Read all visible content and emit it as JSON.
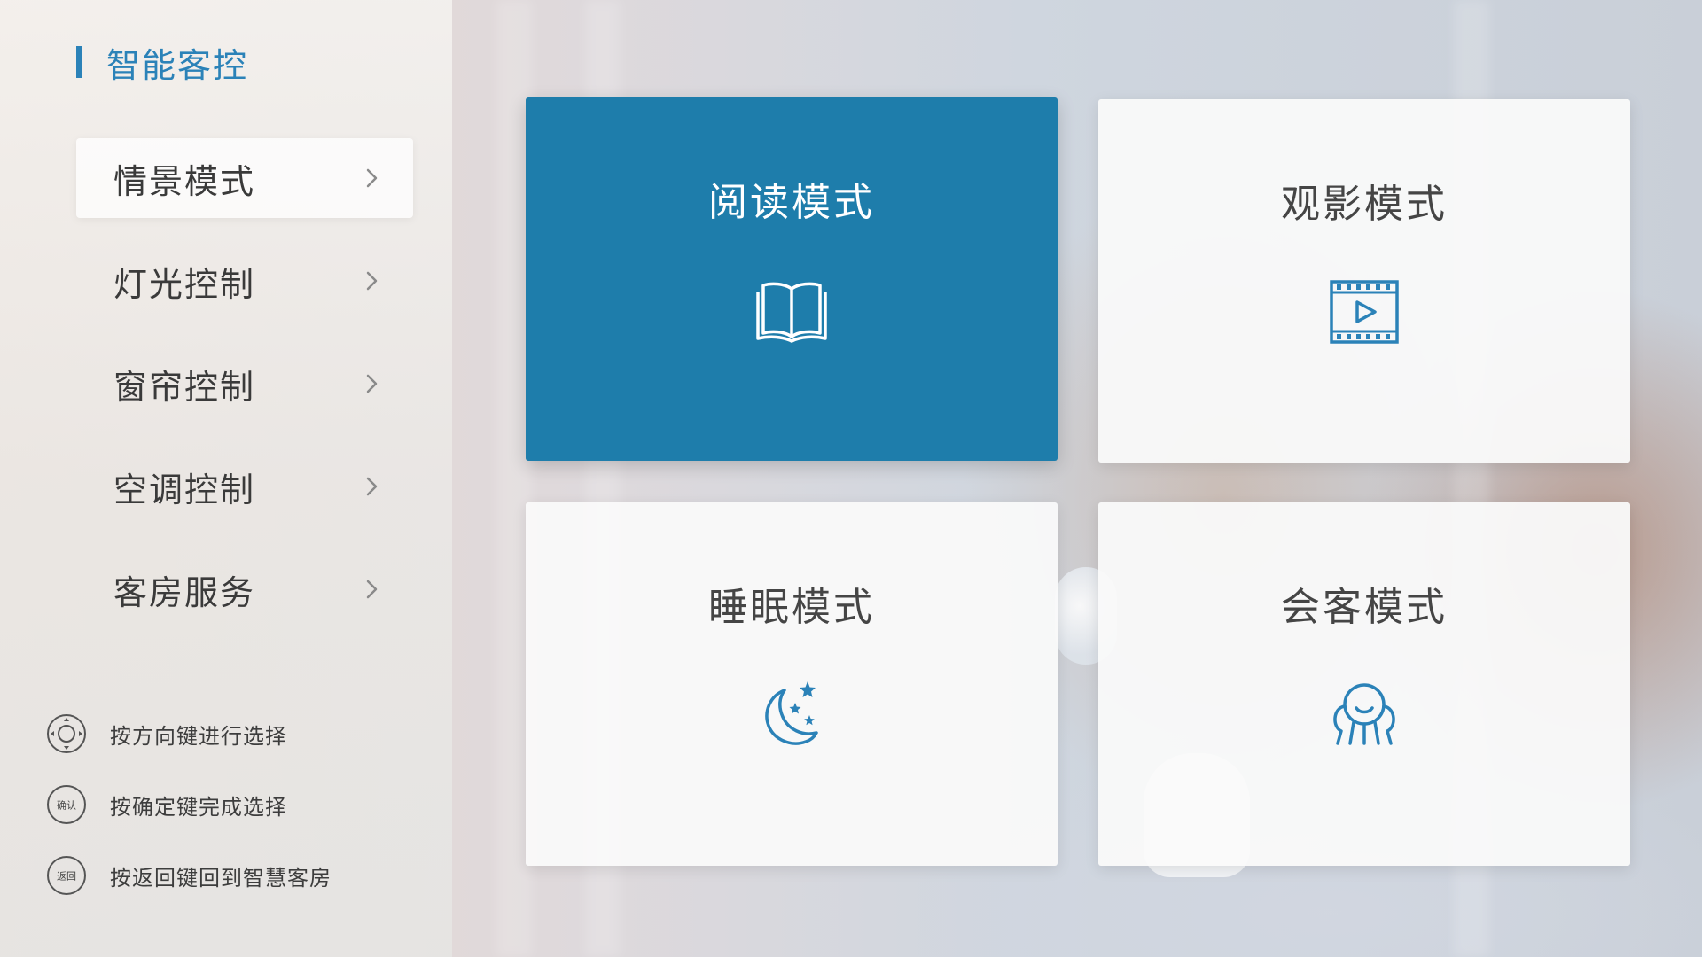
{
  "app": {
    "title": "智能客控"
  },
  "sidebar": {
    "items": [
      {
        "label": "情景模式",
        "active": true
      },
      {
        "label": "灯光控制",
        "active": false
      },
      {
        "label": "窗帘控制",
        "active": false
      },
      {
        "label": "空调控制",
        "active": false
      },
      {
        "label": "客房服务",
        "active": false
      }
    ],
    "hints": [
      {
        "icon": "dpad-icon",
        "text": "按方向键进行选择"
      },
      {
        "icon": "confirm-key-icon",
        "icon_label": "确认",
        "text": "按确定键完成选择"
      },
      {
        "icon": "back-key-icon",
        "icon_label": "返回",
        "text": "按返回键回到智慧客房"
      }
    ]
  },
  "modes": [
    {
      "label": "阅读模式",
      "icon": "book-icon",
      "active": true
    },
    {
      "label": "观影模式",
      "icon": "film-icon",
      "active": false
    },
    {
      "label": "睡眠模式",
      "icon": "moon-stars-icon",
      "active": false
    },
    {
      "label": "会客模式",
      "icon": "guests-icon",
      "active": false
    }
  ],
  "colors": {
    "accent": "#1e7dab",
    "brand": "#2b82b8",
    "icon_blue": "#2b82b8"
  }
}
